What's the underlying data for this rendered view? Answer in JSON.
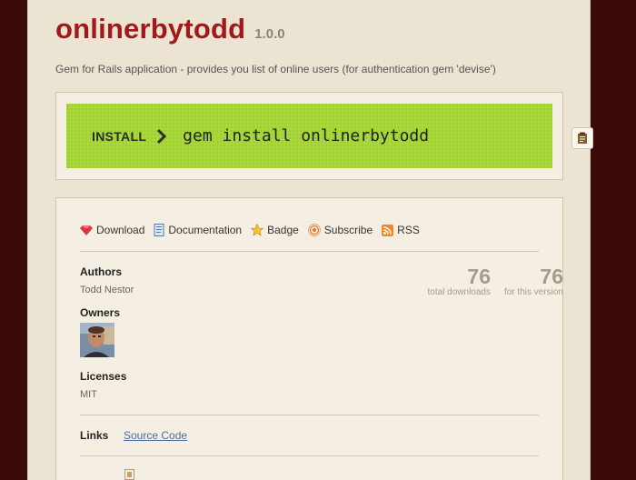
{
  "gem": {
    "name": "onlinerbytodd",
    "version": "1.0.0",
    "description": "Gem for Rails application - provides you list of online users (for authentication gem 'devise')"
  },
  "install": {
    "label": "INSTALL",
    "command": "gem install onlinerbytodd"
  },
  "links": [
    {
      "label": "Download",
      "icon": "gem-icon"
    },
    {
      "label": "Documentation",
      "icon": "document-icon"
    },
    {
      "label": "Badge",
      "icon": "star-badge-icon"
    },
    {
      "label": "Subscribe",
      "icon": "subscribe-icon"
    },
    {
      "label": "RSS",
      "icon": "rss-icon"
    }
  ],
  "authors": {
    "label": "Authors",
    "value": "Todd Nestor"
  },
  "owners": {
    "label": "Owners"
  },
  "licenses": {
    "label": "Licenses",
    "value": "MIT"
  },
  "stats": {
    "total": {
      "num": "76",
      "caption": "total downloads"
    },
    "version": {
      "num": "76",
      "caption": "for this version"
    }
  },
  "links_section": {
    "label": "Links",
    "source_code": "Source Code"
  },
  "colors": {
    "accent": "#a11a1a",
    "install_green": "#a8d83a",
    "background": "#3a0a0a",
    "panel": "#ece4d3"
  }
}
